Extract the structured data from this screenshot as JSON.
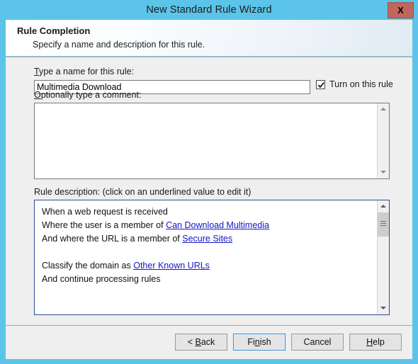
{
  "window": {
    "title": "New Standard Rule Wizard",
    "close_label": "X",
    "accent_title_bar": "#5bc4e8",
    "close_button_color": "#c0675d"
  },
  "header": {
    "title": "Rule Completion",
    "subtitle": "Specify a name and description for this rule."
  },
  "form": {
    "name_label_accel": "T",
    "name_label_rest": "ype a name for this rule:",
    "name_value": "Multimedia Download",
    "name_placeholder": "",
    "turn_on_label": "Turn on this rule",
    "turn_on_checked": true,
    "comment_label_accel": "O",
    "comment_label_rest": "ptionally type a comment:",
    "comment_value": "",
    "comment_placeholder": ""
  },
  "description": {
    "label": "Rule description: (click on an underlined value to edit it)",
    "link_color": "#1414c8",
    "lines": [
      {
        "prefix": "When a web request is received",
        "link": "",
        "suffix": ""
      },
      {
        "prefix": "Where the user is a member of ",
        "link": "Can Download Multimedia",
        "suffix": ""
      },
      {
        "prefix": "And where the URL is a member of ",
        "link": "Secure Sites",
        "suffix": ""
      },
      {
        "prefix": "",
        "link": "",
        "suffix": ""
      },
      {
        "prefix": "Classify the domain as ",
        "link": "Other Known URLs",
        "suffix": ""
      },
      {
        "prefix": "And continue processing rules",
        "link": "",
        "suffix": ""
      }
    ]
  },
  "footer": {
    "buttons": [
      {
        "prefix": "< ",
        "accel": "B",
        "rest": "ack"
      },
      {
        "prefix": "Fi",
        "accel": "n",
        "rest": "ish"
      },
      {
        "prefix": "Cancel",
        "accel": "",
        "rest": ""
      },
      {
        "prefix": "",
        "accel": "H",
        "rest": "elp"
      }
    ]
  }
}
